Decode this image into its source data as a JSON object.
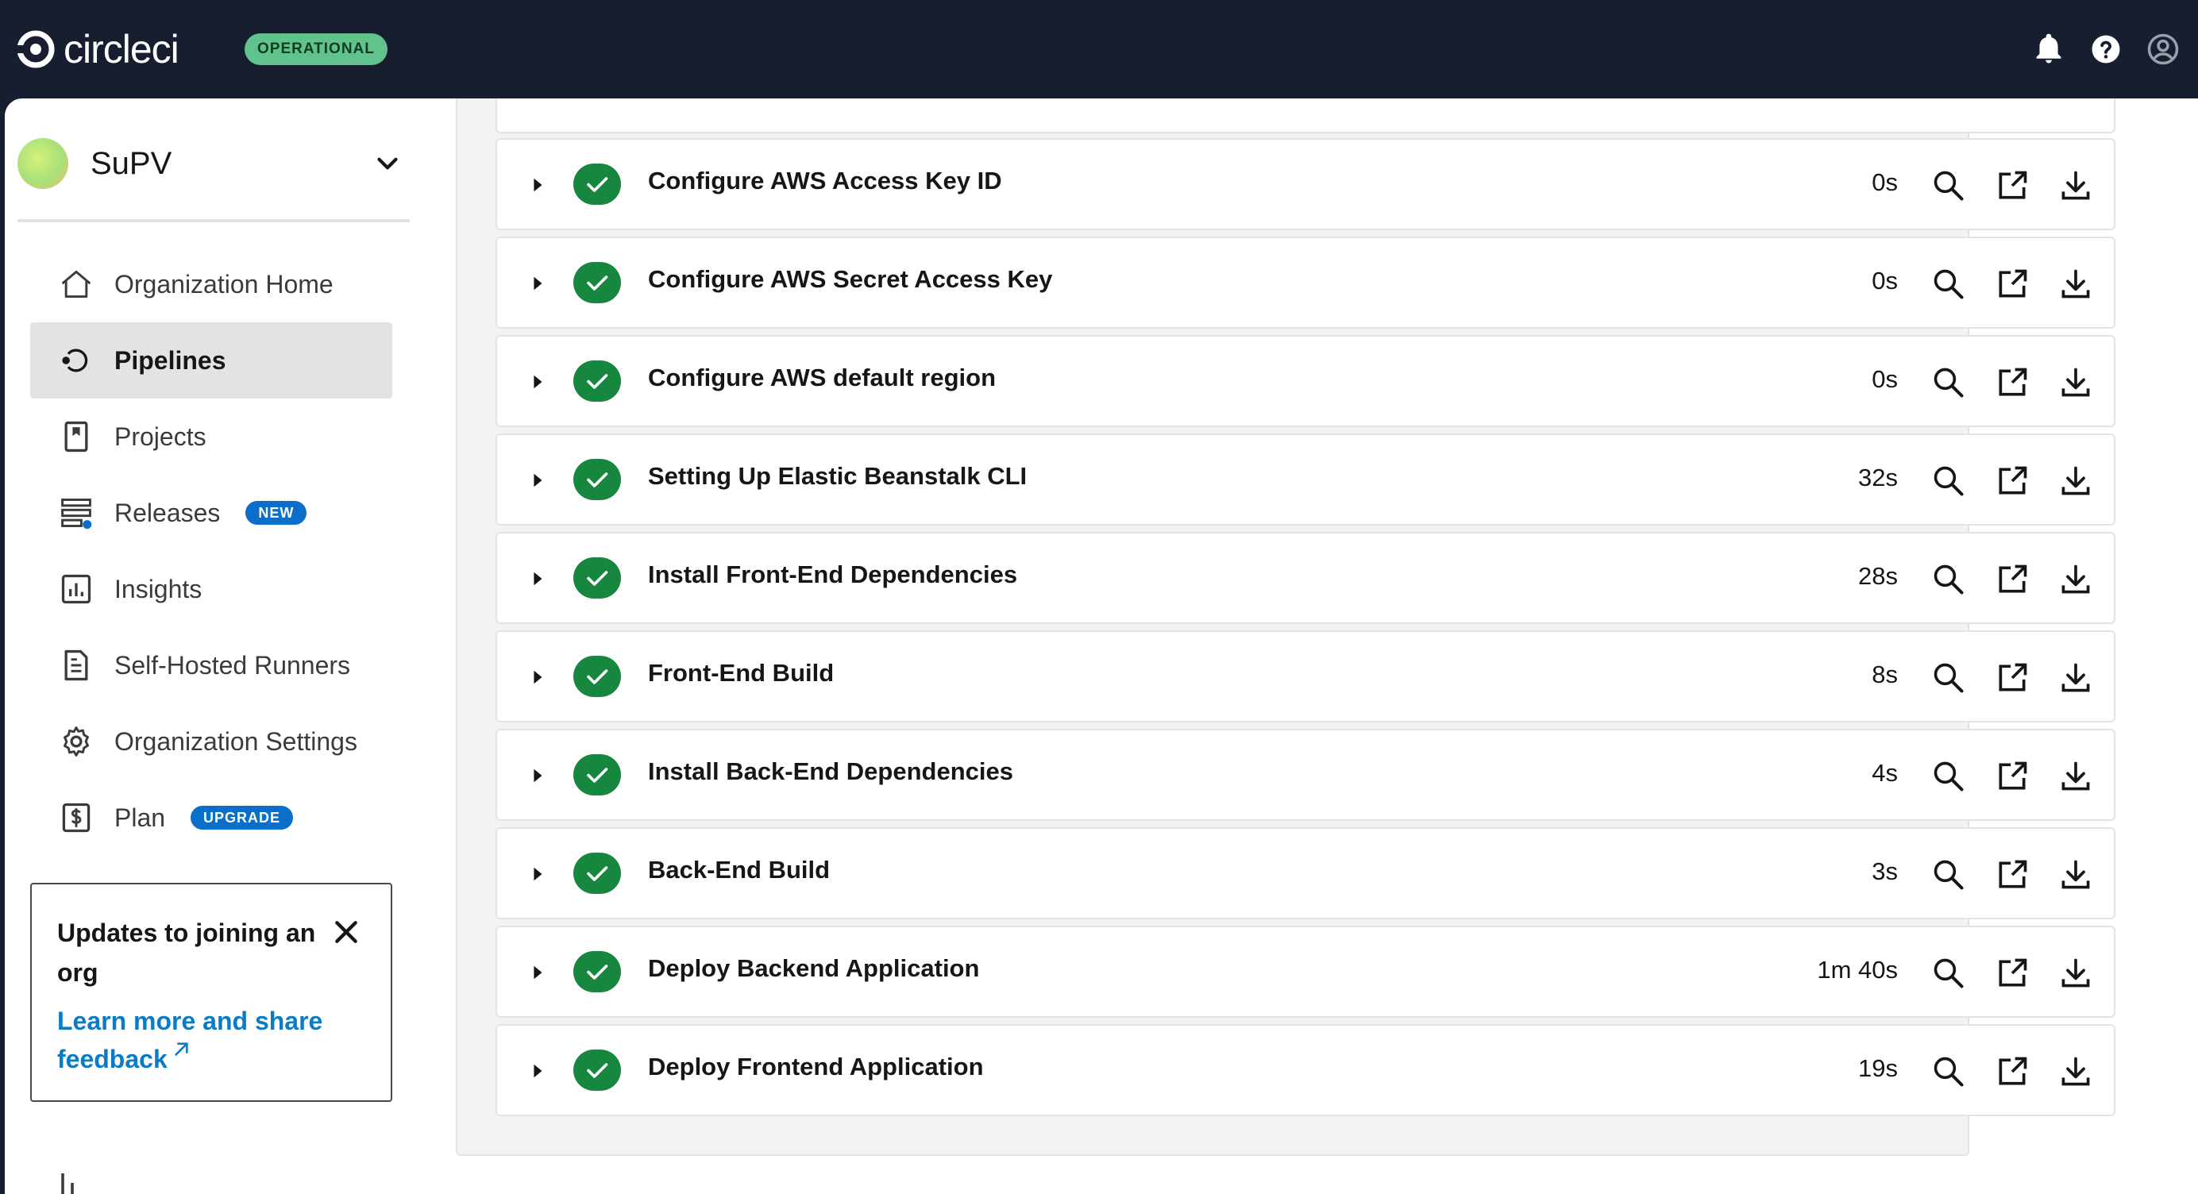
{
  "header": {
    "logo_text": "circleci",
    "status": "OPERATIONAL",
    "icons": [
      "bell-icon",
      "help-icon",
      "user-account-icon"
    ]
  },
  "colors": {
    "topbar": "#161e2f",
    "status_green": "#61c28c",
    "success_green": "#17873f",
    "badge_blue": "#0b6ec8",
    "link_blue": "#0b7bc6"
  },
  "sidebar": {
    "org_name": "SuPV",
    "items": [
      {
        "label": "Organization Home",
        "icon": "home-icon",
        "active": false,
        "badge": ""
      },
      {
        "label": "Pipelines",
        "icon": "pipelines-icon",
        "active": true,
        "badge": ""
      },
      {
        "label": "Projects",
        "icon": "projects-icon",
        "active": false,
        "badge": ""
      },
      {
        "label": "Releases",
        "icon": "releases-icon",
        "active": false,
        "badge": "NEW"
      },
      {
        "label": "Insights",
        "icon": "insights-icon",
        "active": false,
        "badge": ""
      },
      {
        "label": "Self-Hosted Runners",
        "icon": "runners-icon",
        "active": false,
        "badge": ""
      },
      {
        "label": "Organization Settings",
        "icon": "gear-icon",
        "active": false,
        "badge": ""
      },
      {
        "label": "Plan",
        "icon": "plan-icon",
        "active": false,
        "badge": "UPGRADE"
      }
    ],
    "notice": {
      "title": "Updates to joining an org",
      "link": "Learn more and share feedback"
    }
  },
  "steps": [
    {
      "name": "Configure AWS Access Key ID",
      "duration": "0s",
      "status": "success"
    },
    {
      "name": "Configure AWS Secret Access Key",
      "duration": "0s",
      "status": "success"
    },
    {
      "name": "Configure AWS default region",
      "duration": "0s",
      "status": "success"
    },
    {
      "name": "Setting Up Elastic Beanstalk CLI",
      "duration": "32s",
      "status": "success"
    },
    {
      "name": "Install Front-End Dependencies",
      "duration": "28s",
      "status": "success"
    },
    {
      "name": "Front-End Build",
      "duration": "8s",
      "status": "success"
    },
    {
      "name": "Install Back-End Dependencies",
      "duration": "4s",
      "status": "success"
    },
    {
      "name": "Back-End Build",
      "duration": "3s",
      "status": "success"
    },
    {
      "name": "Deploy Backend Application",
      "duration": "1m 40s",
      "status": "success"
    },
    {
      "name": "Deploy Frontend Application",
      "duration": "19s",
      "status": "success"
    }
  ]
}
